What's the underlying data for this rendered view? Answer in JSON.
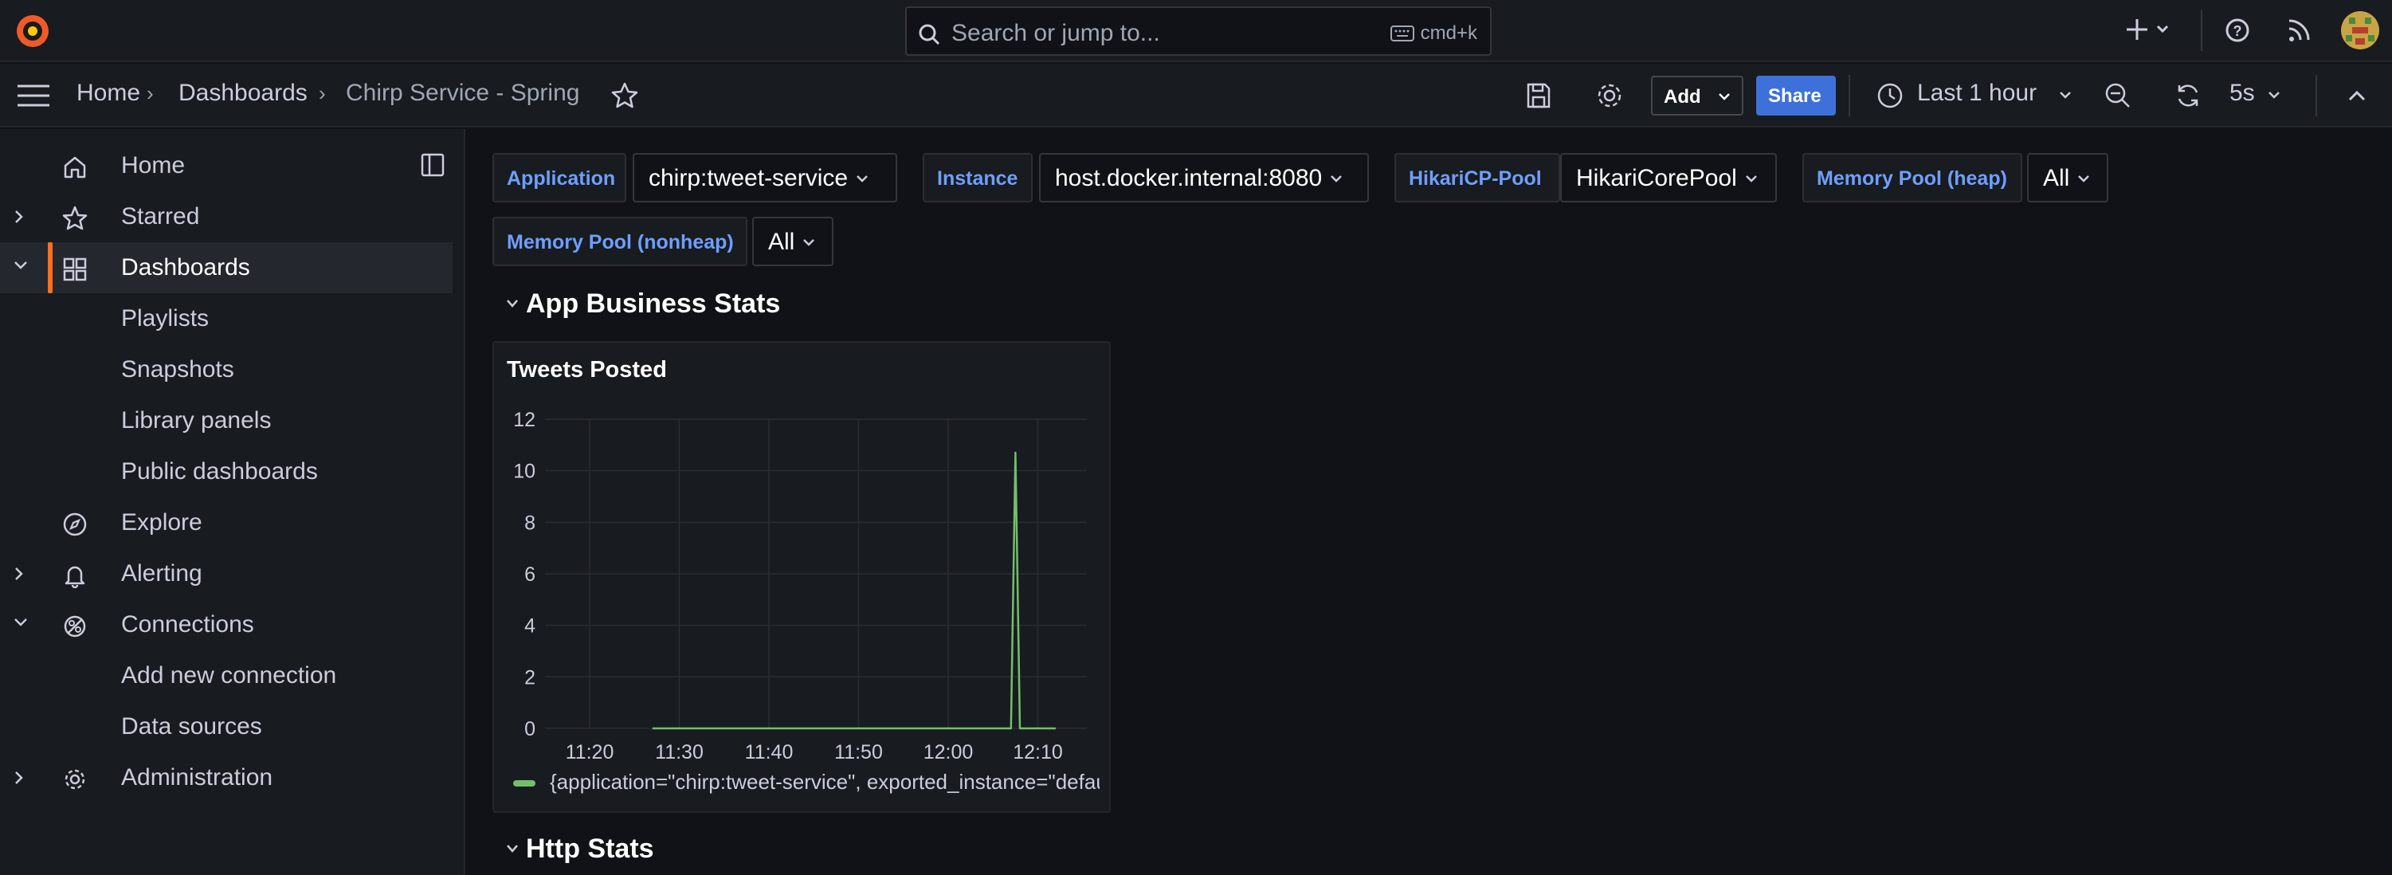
{
  "topbar": {
    "search_placeholder": "Search or jump to...",
    "search_shortcut": "cmd+k",
    "icons": [
      "grafana-logo-icon",
      "plus-icon",
      "help-icon",
      "rss-icon",
      "user-avatar"
    ]
  },
  "nav": {
    "breadcrumbs": [
      "Home",
      "Dashboards",
      "Chirp Service - Spring"
    ],
    "add_label": "Add",
    "share_label": "Share",
    "time_range": "Last 1 hour",
    "refresh_interval": "5s"
  },
  "sidebar": {
    "items": [
      {
        "label": "Home",
        "icon": "home-icon"
      },
      {
        "label": "Starred",
        "icon": "star-icon"
      },
      {
        "label": "Dashboards",
        "icon": "apps-icon",
        "active": true
      },
      {
        "label": "Playlists"
      },
      {
        "label": "Snapshots"
      },
      {
        "label": "Library panels"
      },
      {
        "label": "Public dashboards"
      },
      {
        "label": "Explore",
        "icon": "compass-icon"
      },
      {
        "label": "Alerting",
        "icon": "bell-icon"
      },
      {
        "label": "Connections",
        "icon": "connections-icon"
      },
      {
        "label": "Add new connection"
      },
      {
        "label": "Data sources"
      },
      {
        "label": "Administration",
        "icon": "gear-icon"
      }
    ]
  },
  "variables": [
    {
      "label": "Application",
      "value": "chirp:tweet-service"
    },
    {
      "label": "Instance",
      "value": "host.docker.internal:8080"
    },
    {
      "label": "HikariCP-Pool",
      "value": "HikariCorePool"
    },
    {
      "label": "Memory Pool (heap)",
      "value": "All"
    },
    {
      "label": "Memory Pool (nonheap)",
      "value": "All"
    }
  ],
  "rows": {
    "business": "App Business Stats",
    "http": "Http Stats"
  },
  "panel": {
    "title": "Tweets Posted",
    "legend": "{application=\"chirp:tweet-service\", exported_instance=\"default\"}"
  },
  "colors": {
    "accent": "#ff6f1f",
    "series": "#73bf69",
    "link": "#6e9fff",
    "share": "#3d71d9"
  },
  "chart_data": {
    "type": "line",
    "title": "Tweets Posted",
    "xlabel": "",
    "ylabel": "",
    "x_ticks": [
      "11:20",
      "11:30",
      "11:40",
      "11:50",
      "12:00",
      "12:10"
    ],
    "y_ticks": [
      0,
      2,
      4,
      6,
      8,
      10,
      12
    ],
    "ylim": [
      0,
      12
    ],
    "grid": true,
    "legend_position": "bottom",
    "series": [
      {
        "name": "{application=\"chirp:tweet-service\", exported_instance=\"default\"}",
        "color": "#73bf69",
        "x": [
          "11:27",
          "11:40",
          "11:50",
          "12:00",
          "12:06",
          "12:07",
          "12:07:30",
          "12:08",
          "12:09",
          "12:12"
        ],
        "y": [
          0,
          0,
          0,
          0,
          0,
          0,
          10.7,
          0,
          0,
          0
        ]
      }
    ]
  }
}
